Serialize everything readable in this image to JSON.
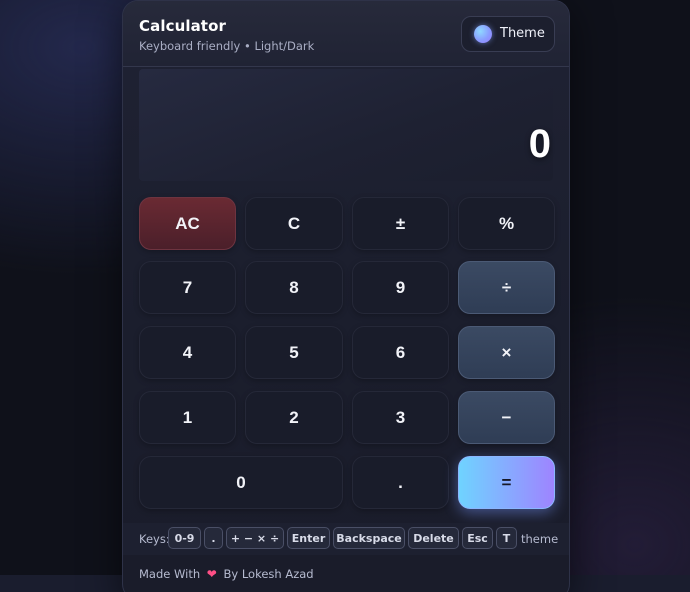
{
  "header": {
    "title": "Calculator",
    "subtitle": "Keyboard friendly • Light/Dark",
    "theme_button_label": "Theme"
  },
  "display": {
    "value": "0"
  },
  "keypad": {
    "row1": [
      "AC",
      "C",
      "±",
      "%"
    ],
    "row2": [
      "7",
      "8",
      "9",
      "÷"
    ],
    "row3": [
      "4",
      "5",
      "6",
      "×"
    ],
    "row4": [
      "1",
      "2",
      "3",
      "−"
    ],
    "row5": [
      "0",
      ".",
      "="
    ]
  },
  "shortcuts": {
    "prefix": "Keys:",
    "keys": [
      "0-9",
      ".",
      "+ − × ÷",
      "Enter",
      "Backspace",
      "Delete",
      "Esc",
      "T"
    ],
    "suffix": "theme"
  },
  "footer": {
    "made_with": "Made With",
    "author": "By Lokesh Azad",
    "heart_icon": "heart-icon"
  },
  "colors": {
    "background": "#0f111a",
    "card": "#1b1e2d",
    "clear_key": "#5a2530",
    "operator_key": "#354460",
    "equals_gradient_start": "#6fd3ff",
    "equals_gradient_end": "#9e84ff",
    "heart": "#ff4f86"
  }
}
